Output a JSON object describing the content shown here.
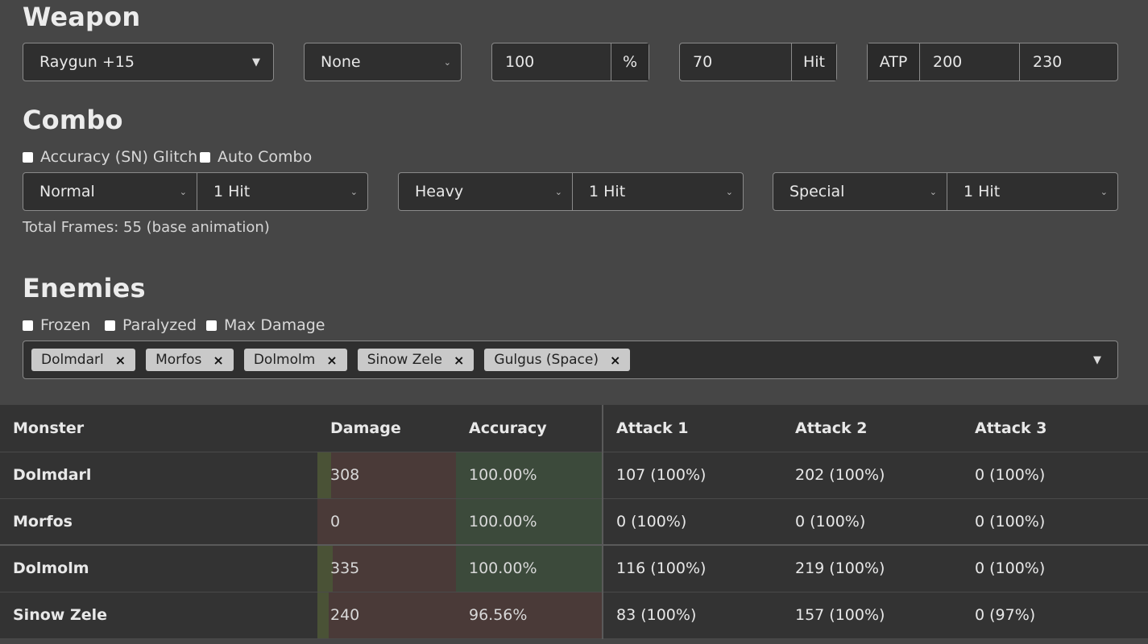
{
  "weapon": {
    "heading": "Weapon",
    "weapon_select": "Raygun +15",
    "special_select": "None",
    "percent_value": "100",
    "percent_addon": "%",
    "hit_value": "70",
    "hit_addon": "Hit",
    "atp_label": "ATP",
    "atp_min": "200",
    "atp_max": "230"
  },
  "combo": {
    "heading": "Combo",
    "options": [
      {
        "label": "Accuracy (SN) Glitch",
        "checked": false
      },
      {
        "label": "Auto Combo",
        "checked": false
      }
    ],
    "attacks": [
      {
        "type": "Normal",
        "hits": "1 Hit"
      },
      {
        "type": "Heavy",
        "hits": "1 Hit"
      },
      {
        "type": "Special",
        "hits": "1 Hit"
      }
    ],
    "total_frames": "Total Frames: 55 (base animation)"
  },
  "enemies": {
    "heading": "Enemies",
    "options": [
      {
        "label": "Frozen",
        "checked": false
      },
      {
        "label": "Paralyzed",
        "checked": false
      },
      {
        "label": "Max Damage",
        "checked": false
      }
    ],
    "selected": [
      "Dolmdarl",
      "Morfos",
      "Dolmolm",
      "Sinow Zele",
      "Gulgus (Space)"
    ],
    "remove_glyph": "×"
  },
  "table": {
    "headers": [
      "Monster",
      "Damage",
      "Accuracy",
      "Attack 1",
      "Attack 2",
      "Attack 3"
    ],
    "rows": [
      {
        "monster": "Dolmdarl",
        "damage": "308",
        "accuracy": "100.00%",
        "attack1": "107 (100%)",
        "attack2": "202 (100%)",
        "attack3": "0 (100%)",
        "damage_fill": 0.1
      },
      {
        "monster": "Morfos",
        "damage": "0",
        "accuracy": "100.00%",
        "attack1": "0 (100%)",
        "attack2": "0 (100%)",
        "attack3": "0 (100%)",
        "damage_fill": 0.0
      },
      {
        "monster": "Dolmolm",
        "damage": "335",
        "accuracy": "100.00%",
        "attack1": "116 (100%)",
        "attack2": "219 (100%)",
        "attack3": "0 (100%)",
        "damage_fill": 0.11
      },
      {
        "monster": "Sinow Zele",
        "damage": "240",
        "accuracy": "96.56%",
        "attack1": "83 (100%)",
        "attack2": "157 (100%)",
        "attack3": "0 (97%)",
        "damage_fill": 0.08
      }
    ]
  },
  "colors": {
    "good": "#3c4a3b",
    "bad": "#4a3a38",
    "damage_fill": "#4a5236"
  }
}
